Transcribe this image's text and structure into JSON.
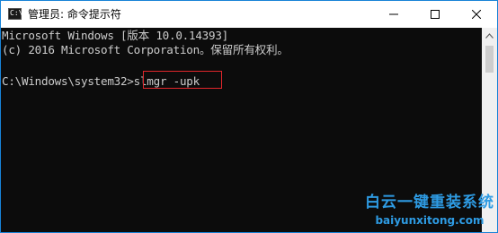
{
  "window": {
    "title": "管理员: 命令提示符",
    "icon": "cmd-icon",
    "icon_glyph": "C:\\",
    "controls": {
      "minimize_icon": "minimize-icon",
      "maximize_icon": "maximize-icon",
      "close_icon": "close-icon"
    }
  },
  "console": {
    "lines": [
      "Microsoft Windows [版本 10.0.14393]",
      "(c) 2016 Microsoft Corporation。保留所有权利。",
      "C:\\Windows\\system32>slmgr -upk"
    ],
    "highlighted_command": "slmgr -upk",
    "highlight_color": "#e0262b",
    "background_color": "#0c0c0c",
    "text_color": "#cccccc"
  },
  "watermark": {
    "brand": "白云一键重装系统",
    "url": "baiyunxitong.com",
    "color": "#2e9be3"
  }
}
